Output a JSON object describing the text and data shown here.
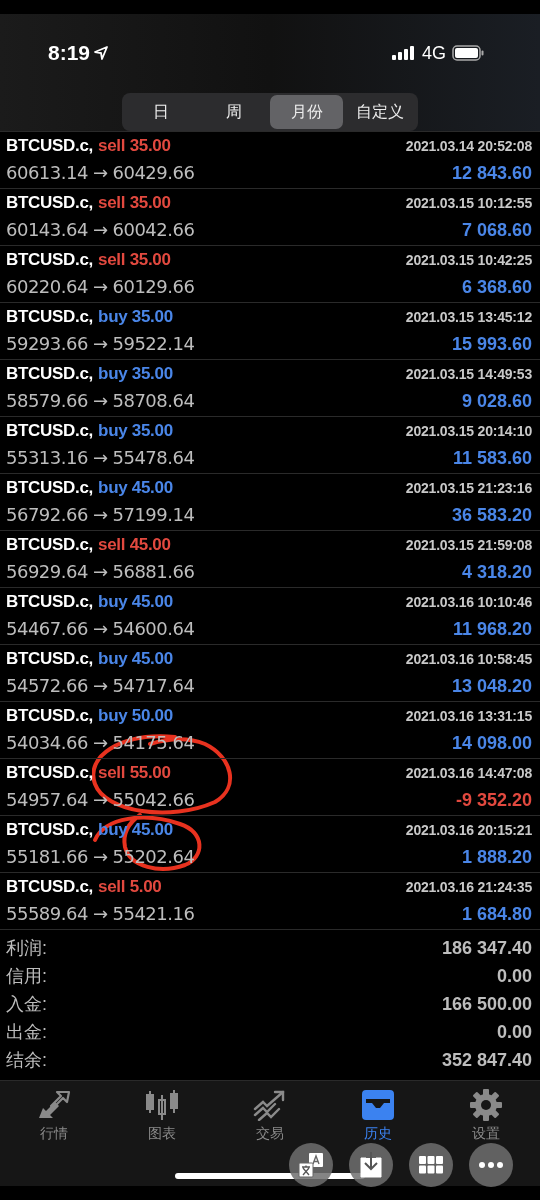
{
  "status_bar": {
    "time": "8:19",
    "network": "4G"
  },
  "periods": [
    {
      "label": "日",
      "selected": false
    },
    {
      "label": "周",
      "selected": false
    },
    {
      "label": "月份",
      "selected": true
    },
    {
      "label": "自定义",
      "selected": false
    }
  ],
  "trades": [
    {
      "symbol": "BTCUSD.c,",
      "kind": "sell",
      "order": "sell 35.00",
      "time": "2021.03.14 20:52:08",
      "open": "60613.14",
      "arrow": "→",
      "close": "60429.66",
      "profit": "12 843.60",
      "loss": false
    },
    {
      "symbol": "BTCUSD.c,",
      "kind": "sell",
      "order": "sell 35.00",
      "time": "2021.03.15 10:12:55",
      "open": "60143.64",
      "arrow": "→",
      "close": "60042.66",
      "profit": "7 068.60",
      "loss": false
    },
    {
      "symbol": "BTCUSD.c,",
      "kind": "sell",
      "order": "sell 35.00",
      "time": "2021.03.15 10:42:25",
      "open": "60220.64",
      "arrow": "→",
      "close": "60129.66",
      "profit": "6 368.60",
      "loss": false
    },
    {
      "symbol": "BTCUSD.c,",
      "kind": "buy",
      "order": "buy 35.00",
      "time": "2021.03.15 13:45:12",
      "open": "59293.66",
      "arrow": "→",
      "close": "59522.14",
      "profit": "15 993.60",
      "loss": false
    },
    {
      "symbol": "BTCUSD.c,",
      "kind": "buy",
      "order": "buy 35.00",
      "time": "2021.03.15 14:49:53",
      "open": "58579.66",
      "arrow": "→",
      "close": "58708.64",
      "profit": "9 028.60",
      "loss": false
    },
    {
      "symbol": "BTCUSD.c,",
      "kind": "buy",
      "order": "buy 35.00",
      "time": "2021.03.15 20:14:10",
      "open": "55313.16",
      "arrow": "→",
      "close": "55478.64",
      "profit": "11 583.60",
      "loss": false
    },
    {
      "symbol": "BTCUSD.c,",
      "kind": "buy",
      "order": "buy 45.00",
      "time": "2021.03.15 21:23:16",
      "open": "56792.66",
      "arrow": "→",
      "close": "57199.14",
      "profit": "36 583.20",
      "loss": false
    },
    {
      "symbol": "BTCUSD.c,",
      "kind": "sell",
      "order": "sell 45.00",
      "time": "2021.03.15 21:59:08",
      "open": "56929.64",
      "arrow": "→",
      "close": "56881.66",
      "profit": "4 318.20",
      "loss": false
    },
    {
      "symbol": "BTCUSD.c,",
      "kind": "buy",
      "order": "buy 45.00",
      "time": "2021.03.16 10:10:46",
      "open": "54467.66",
      "arrow": "→",
      "close": "54600.64",
      "profit": "11 968.20",
      "loss": false
    },
    {
      "symbol": "BTCUSD.c,",
      "kind": "buy",
      "order": "buy 45.00",
      "time": "2021.03.16 10:58:45",
      "open": "54572.66",
      "arrow": "→",
      "close": "54717.64",
      "profit": "13 048.20",
      "loss": false
    },
    {
      "symbol": "BTCUSD.c,",
      "kind": "buy",
      "order": "buy 50.00",
      "time": "2021.03.16 13:31:15",
      "open": "54034.66",
      "arrow": "→",
      "close": "54175.64",
      "profit": "14 098.00",
      "loss": false
    },
    {
      "symbol": "BTCUSD.c,",
      "kind": "sell",
      "order": "sell 55.00",
      "time": "2021.03.16 14:47:08",
      "open": "54957.64",
      "arrow": "→",
      "close": "55042.66",
      "profit": "-9 352.20",
      "loss": true
    },
    {
      "symbol": "BTCUSD.c,",
      "kind": "buy",
      "order": "buy 45.00",
      "time": "2021.03.16 20:15:21",
      "open": "55181.66",
      "arrow": "→",
      "close": "55202.64",
      "profit": "1 888.20",
      "loss": false
    },
    {
      "symbol": "BTCUSD.c,",
      "kind": "sell",
      "order": "sell 5.00",
      "time": "2021.03.16 21:24:35",
      "open": "55589.64",
      "arrow": "→",
      "close": "55421.16",
      "profit": "1 684.80",
      "loss": false
    }
  ],
  "summary": [
    {
      "label": "利润:",
      "value": "186 347.40"
    },
    {
      "label": "信用:",
      "value": "0.00"
    },
    {
      "label": "入金:",
      "value": "166 500.00"
    },
    {
      "label": "出金:",
      "value": "0.00"
    },
    {
      "label": "结余:",
      "value": "352 847.40"
    }
  ],
  "tabs": [
    {
      "label": "行情",
      "kind": "quotes",
      "selected": false
    },
    {
      "label": "图表",
      "kind": "chart",
      "selected": false
    },
    {
      "label": "交易",
      "kind": "trade",
      "selected": false
    },
    {
      "label": "历史",
      "kind": "history",
      "selected": true
    },
    {
      "label": "设置",
      "kind": "settings",
      "selected": false
    }
  ],
  "floating_tools": [
    {
      "kind": "translate"
    },
    {
      "kind": "download"
    },
    {
      "kind": "grid"
    },
    {
      "kind": "more"
    }
  ]
}
